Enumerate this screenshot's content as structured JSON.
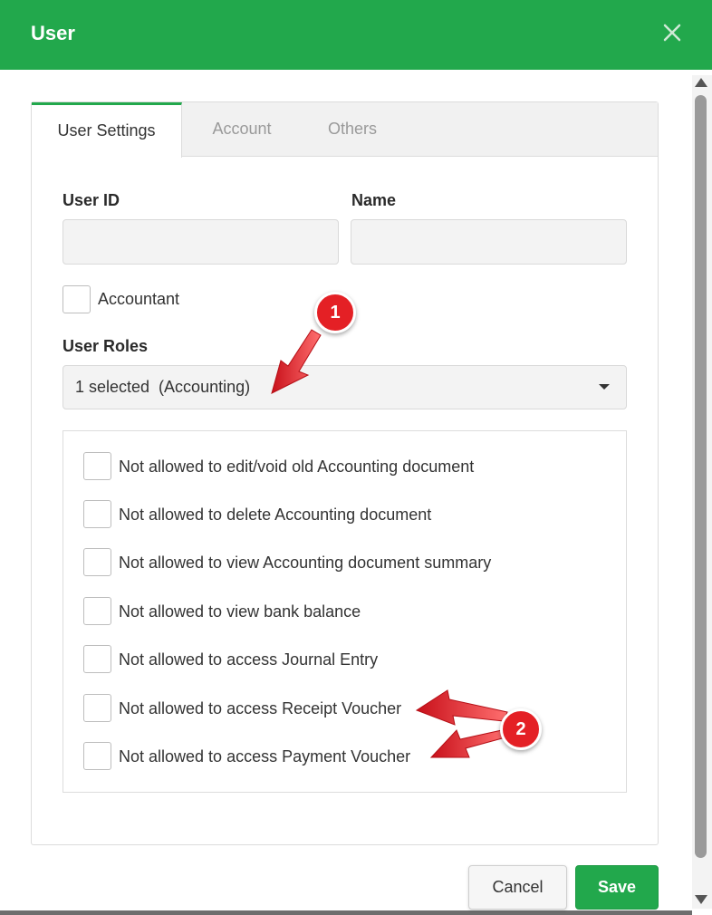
{
  "header": {
    "title": "User"
  },
  "tabs": [
    {
      "label": "User Settings",
      "active": true
    },
    {
      "label": "Account",
      "active": false
    },
    {
      "label": "Others",
      "active": false
    }
  ],
  "form": {
    "user_id": {
      "label": "User ID",
      "value": ""
    },
    "name": {
      "label": "Name",
      "value": ""
    },
    "accountant": {
      "label": "Accountant",
      "checked": false
    },
    "user_roles": {
      "label": "User Roles",
      "selected": "1 selected  (Accounting)"
    }
  },
  "permissions": [
    {
      "label": "Not allowed to edit/void old Accounting document",
      "checked": false
    },
    {
      "label": "Not allowed to delete Accounting document",
      "checked": false
    },
    {
      "label": "Not allowed to view Accounting document summary",
      "checked": false
    },
    {
      "label": "Not allowed to view bank balance",
      "checked": false
    },
    {
      "label": "Not allowed to access Journal Entry",
      "checked": false
    },
    {
      "label": "Not allowed to access Receipt Voucher",
      "checked": false
    },
    {
      "label": "Not allowed to access Payment Voucher",
      "checked": false
    }
  ],
  "footer": {
    "cancel_label": "Cancel",
    "save_label": "Save"
  },
  "annotations": {
    "marker_1": "1",
    "marker_2": "2"
  },
  "colors": {
    "brand": "#22a84c",
    "annotation": "#e42025"
  }
}
